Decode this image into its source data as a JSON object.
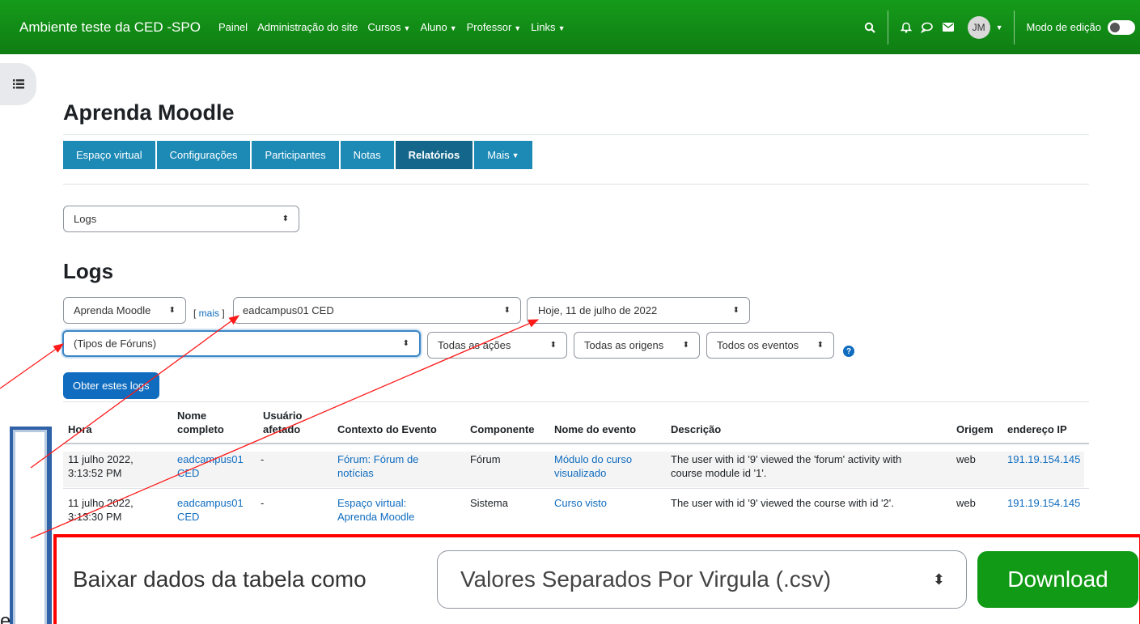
{
  "navbar": {
    "site_name": "Ambiente teste da CED -SPO",
    "links": [
      "Painel",
      "Administração do site",
      "Cursos",
      "Aluno",
      "Professor",
      "Links"
    ],
    "user_initials": "JM",
    "edit_mode_label": "Modo de edição"
  },
  "course": {
    "title": "Aprenda Moodle",
    "tabs": [
      "Espaço virtual",
      "Configurações",
      "Participantes",
      "Notas",
      "Relatórios",
      "Mais"
    ],
    "active_tab": "Relatórios"
  },
  "report_select": {
    "value": "Logs"
  },
  "logs": {
    "heading": "Logs",
    "filters": {
      "course": "Aprenda Moodle",
      "mais_label": "mais",
      "user": "eadcampus01 CED",
      "date": "Hoje, 11 de julho de 2022",
      "activity": "(Tipos de Fóruns)",
      "actions": "Todas as ações",
      "origins": "Todas as origens",
      "events": "Todos os eventos"
    },
    "get_logs_button": "Obter estes logs",
    "columns": [
      "Hora",
      "Nome completo",
      "Usuário afetado",
      "Contexto do Evento",
      "Componente",
      "Nome do evento",
      "Descrição",
      "Origem",
      "endereço IP"
    ],
    "rows": [
      {
        "time_line1": "11 julho 2022,",
        "time_line2": "3:13:52 PM",
        "name_line1": "eadcampus01",
        "name_line2": "CED",
        "affected": "-",
        "context_line1": "Fórum: Fórum de",
        "context_line2": "notícias",
        "component": "Fórum",
        "event_line1": "Módulo do curso",
        "event_line2": "visualizado",
        "desc_line1": "The user with id '9' viewed the 'forum' activity with",
        "desc_line2": "course module id '1'.",
        "origin": "web",
        "ip": "191.19.154.145"
      },
      {
        "time_line1": "11 julho 2022,",
        "time_line2": "3:13:30 PM",
        "name_line1": "eadcampus01",
        "name_line2": "CED",
        "affected": "-",
        "context_line1": "Espaço virtual:",
        "context_line2": "Aprenda Moodle",
        "component": "Sistema",
        "event_line1": "Curso visto",
        "event_line2": "",
        "desc_line1": "The user with id '9' viewed the course with id '2'.",
        "desc_line2": "",
        "origin": "web",
        "ip": "191.19.154.145"
      }
    ]
  },
  "download": {
    "label": "Baixar dados da tabela como",
    "format": "Valores Separados Por Virgula (.csv)",
    "button": "Download"
  },
  "blue_box_text": "e",
  "colors": {
    "navbar": "#0f7d13",
    "tab": "#1d8ab6",
    "tab_active": "#14678a",
    "link": "#0f6cbf",
    "download_button": "#119a15",
    "annotation": "#ff0000",
    "box_border": "#2f62a6"
  },
  "icons": [
    "drawer-toggle-icon",
    "search-icon",
    "bell-icon",
    "chat-icon",
    "mail-icon",
    "chevron-down-icon",
    "help-icon",
    "sort-arrows-icon"
  ]
}
